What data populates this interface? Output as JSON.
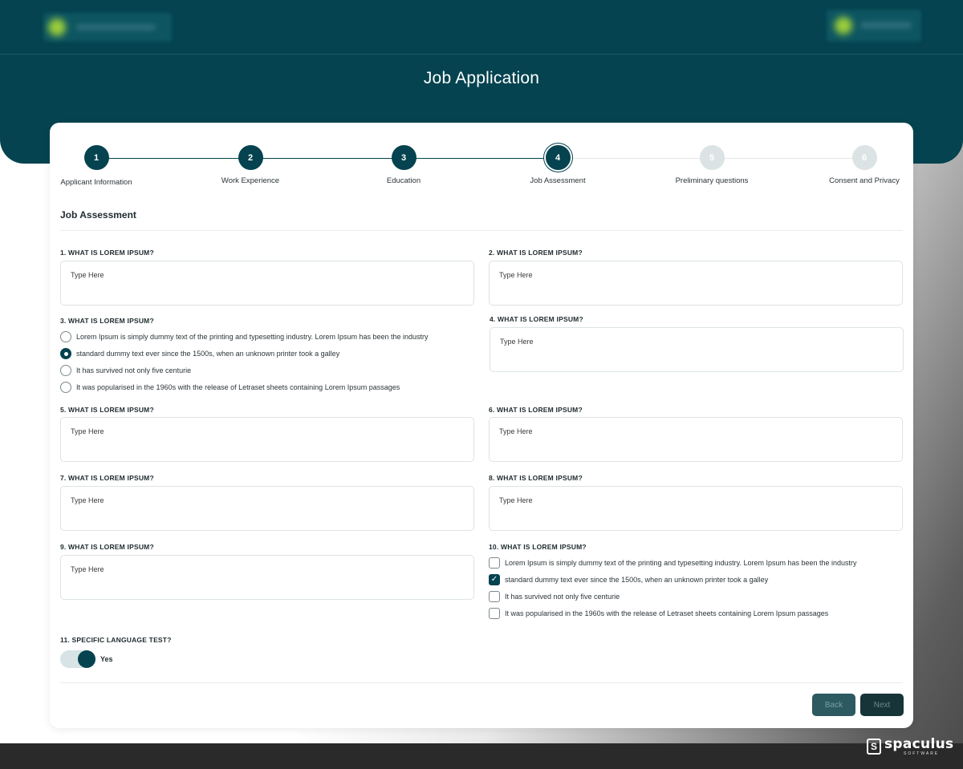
{
  "header": {
    "title": "Job Application"
  },
  "stepper": {
    "steps": [
      {
        "number": "1",
        "label": "Applicant Information",
        "state": "done"
      },
      {
        "number": "2",
        "label": "Work Experience",
        "state": "done"
      },
      {
        "number": "3",
        "label": "Education",
        "state": "done"
      },
      {
        "number": "4",
        "label": "Job Assessment",
        "state": "current"
      },
      {
        "number": "5",
        "label": "Preliminary questions",
        "state": "todo"
      },
      {
        "number": "6",
        "label": "Consent and Privacy",
        "state": "todo"
      }
    ]
  },
  "form": {
    "section_title": "Job Assessment",
    "placeholder": "Type Here",
    "q1": "1. WHAT IS LOREM IPSUM?",
    "q2": "2. WHAT IS LOREM IPSUM?",
    "q3": {
      "label": "3. WHAT IS LOREM IPSUM?",
      "options": [
        {
          "text": "Lorem Ipsum is simply dummy text of the printing and typesetting industry. Lorem Ipsum has been the industry",
          "selected": false
        },
        {
          "text": "standard dummy text ever since the 1500s, when an unknown printer took a galley",
          "selected": true
        },
        {
          "text": "It has survived not only five centurie",
          "selected": false
        },
        {
          "text": "It was popularised in the 1960s with the release of Letraset sheets containing Lorem Ipsum passages",
          "selected": false
        }
      ]
    },
    "q4": "4. WHAT IS LOREM IPSUM?",
    "q5": "5. WHAT IS LOREM IPSUM?",
    "q6": "6. WHAT IS LOREM IPSUM?",
    "q7": "7. WHAT IS LOREM IPSUM?",
    "q8": "8. WHAT IS LOREM IPSUM?",
    "q9": "9. WHAT IS LOREM IPSUM?",
    "q10": {
      "label": "10. WHAT IS LOREM IPSUM?",
      "options": [
        {
          "text": "Lorem Ipsum is simply dummy text of the printing and typesetting industry. Lorem Ipsum has been the industry",
          "checked": false
        },
        {
          "text": "standard dummy text ever since the 1500s, when an unknown printer took a galley",
          "checked": true
        },
        {
          "text": "It has survived not only five centurie",
          "checked": false
        },
        {
          "text": "It was popularised in the 1960s with the release of Letraset sheets containing Lorem Ipsum passages",
          "checked": false
        }
      ]
    },
    "q11": {
      "label": "11. SPECIFIC LANGUAGE TEST?",
      "toggle_label": "Yes",
      "value": true
    }
  },
  "actions": {
    "back": "Back",
    "next": "Next"
  },
  "brand": {
    "name": "spaculus",
    "sub": "SOFTWARE"
  },
  "colors": {
    "primary": "#04434f",
    "inactive_step": "#dbe3e4"
  }
}
